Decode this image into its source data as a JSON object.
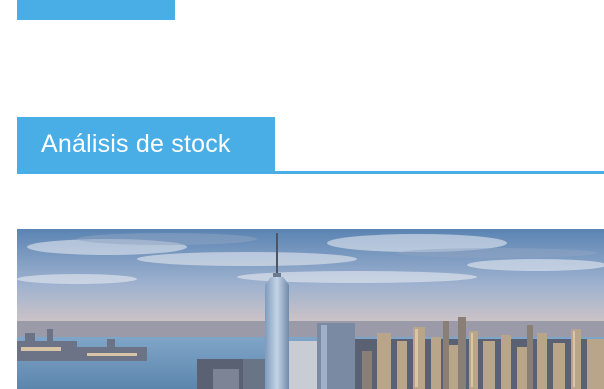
{
  "section": {
    "title": "Análisis de stock"
  },
  "colors": {
    "accent": "#4aaee6",
    "background": "#ffffff"
  },
  "hero": {
    "subject": "city-skyline"
  }
}
